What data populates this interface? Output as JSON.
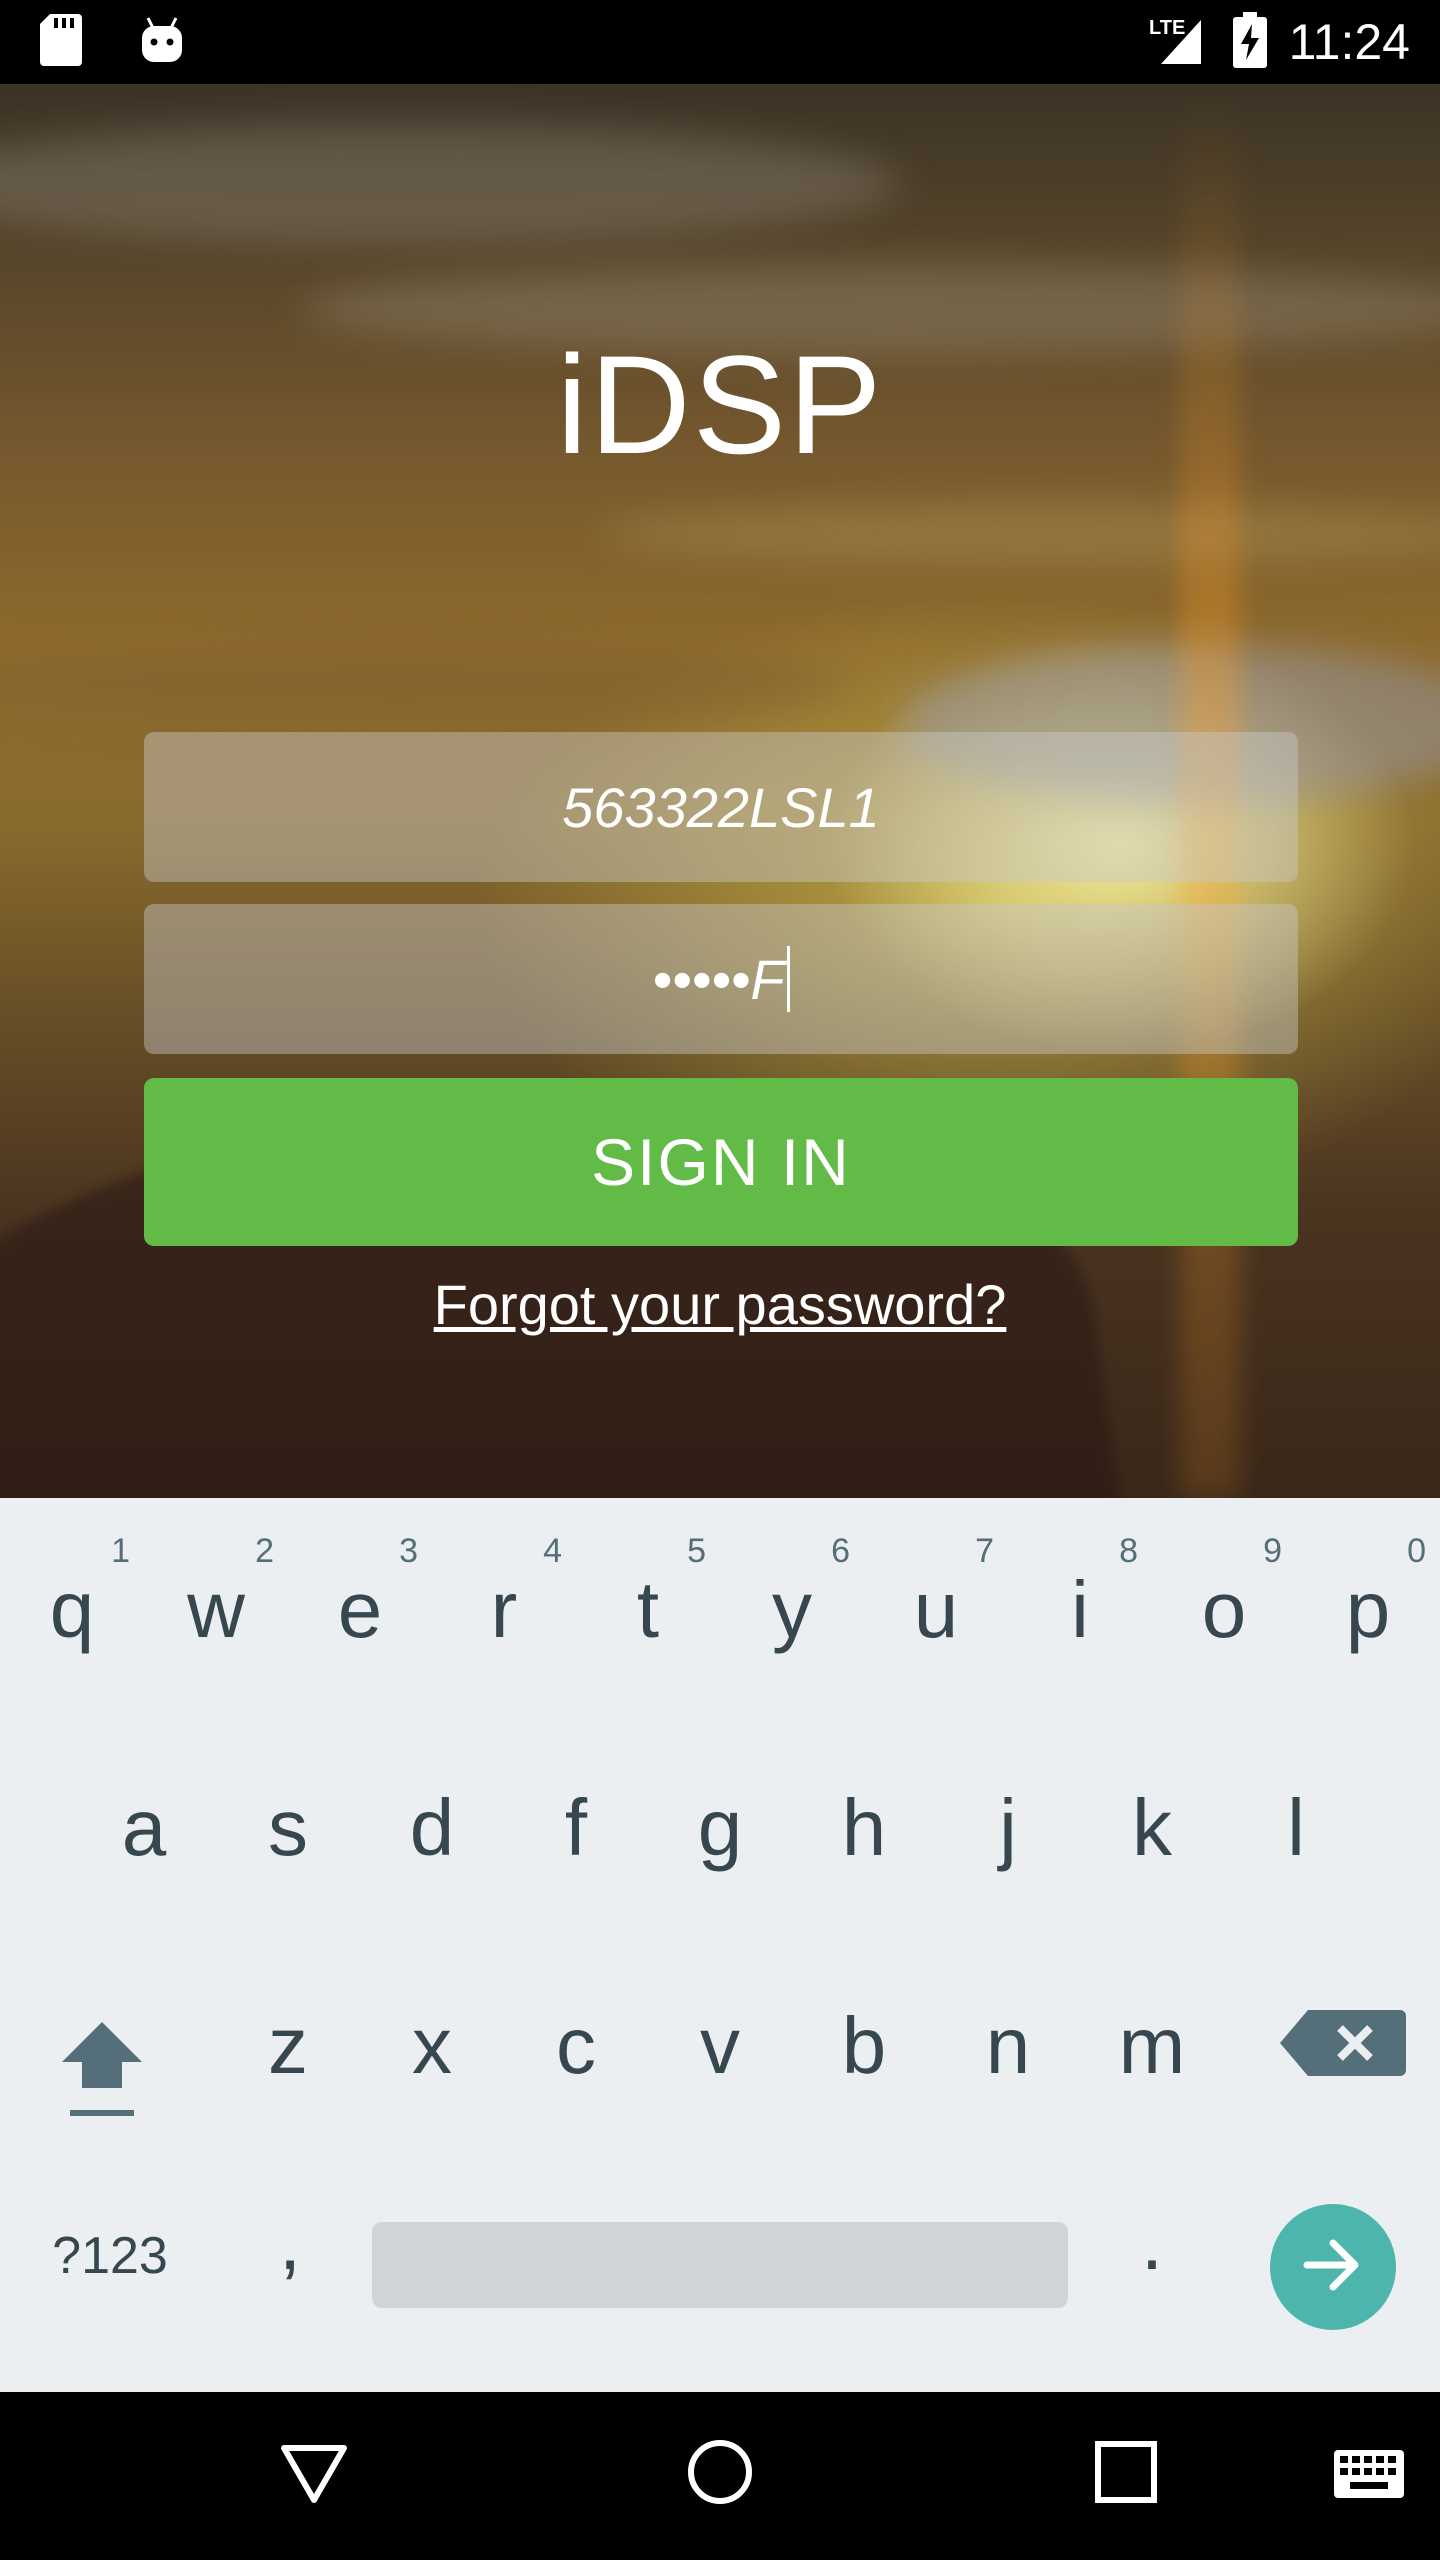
{
  "status_bar": {
    "time": "11:24",
    "network": "LTE",
    "icons": [
      "sd-card-icon",
      "android-icon",
      "signal-icon",
      "battery-charging-icon"
    ]
  },
  "app": {
    "title": "iDSP",
    "username_value": "563322LSL1",
    "password_display": "•••••F",
    "sign_in_label": "SIGN IN",
    "forgot_label": "Forgot your password?",
    "accent_color": "#62bb47"
  },
  "keyboard": {
    "row1": [
      {
        "key": "q",
        "hint": "1"
      },
      {
        "key": "w",
        "hint": "2"
      },
      {
        "key": "e",
        "hint": "3"
      },
      {
        "key": "r",
        "hint": "4"
      },
      {
        "key": "t",
        "hint": "5"
      },
      {
        "key": "y",
        "hint": "6"
      },
      {
        "key": "u",
        "hint": "7"
      },
      {
        "key": "i",
        "hint": "8"
      },
      {
        "key": "o",
        "hint": "9"
      },
      {
        "key": "p",
        "hint": "0"
      }
    ],
    "row2": [
      "a",
      "s",
      "d",
      "f",
      "g",
      "h",
      "j",
      "k",
      "l"
    ],
    "row3": [
      "z",
      "x",
      "c",
      "v",
      "b",
      "n",
      "m"
    ],
    "symbols_label": "?123",
    "comma": ",",
    "period": ".",
    "enter_color": "#4db6ac"
  },
  "nav_bar": {
    "icons": [
      "back-icon",
      "home-icon",
      "recents-icon",
      "keyboard-switch-icon"
    ]
  }
}
